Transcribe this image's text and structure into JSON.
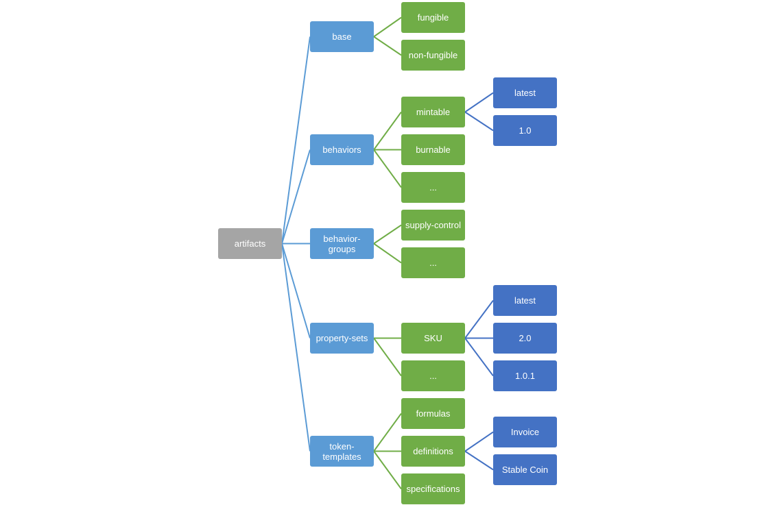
{
  "diagram": {
    "title": "",
    "colors": {
      "root": "#a5a5a5",
      "level1": "#5b9bd5",
      "level2": "#70ad47",
      "level3": "#4472c4",
      "link_level1": "#5b9bd5",
      "link_level2": "#70ad47",
      "link_level3": "#4472c4"
    },
    "root": {
      "id": "artifacts",
      "label": "artifacts",
      "children": [
        {
          "id": "base",
          "label": "base",
          "children": [
            {
              "id": "fungible",
              "label": "fungible",
              "children": []
            },
            {
              "id": "non-fungible",
              "label": "non-fungible",
              "children": []
            }
          ]
        },
        {
          "id": "behaviors",
          "label": "behaviors",
          "children": [
            {
              "id": "mintable",
              "label": "mintable",
              "children": [
                {
                  "id": "mintable-latest",
                  "label": "latest"
                },
                {
                  "id": "mintable-1-0",
                  "label": "1.0"
                }
              ]
            },
            {
              "id": "burnable",
              "label": "burnable",
              "children": []
            },
            {
              "id": "behaviors-more",
              "label": "...",
              "children": []
            }
          ]
        },
        {
          "id": "behavior-groups",
          "label": "behavior-\ngroups",
          "children": [
            {
              "id": "supply-control",
              "label": "supply-control",
              "children": []
            },
            {
              "id": "behavior-groups-more",
              "label": "...",
              "children": []
            }
          ]
        },
        {
          "id": "property-sets",
          "label": "property-sets",
          "children": [
            {
              "id": "sku",
              "label": "SKU",
              "children": [
                {
                  "id": "sku-latest",
                  "label": "latest"
                },
                {
                  "id": "sku-2-0",
                  "label": "2.0"
                },
                {
                  "id": "sku-1-0-1",
                  "label": "1.0.1"
                }
              ]
            },
            {
              "id": "property-sets-more",
              "label": "...",
              "children": []
            }
          ]
        },
        {
          "id": "token-templates",
          "label": "token-\ntemplates",
          "children": [
            {
              "id": "formulas",
              "label": "formulas",
              "children": []
            },
            {
              "id": "definitions",
              "label": "definitions",
              "children": [
                {
                  "id": "invoice",
                  "label": "Invoice"
                },
                {
                  "id": "stable-coin",
                  "label": "Stable Coin"
                }
              ]
            },
            {
              "id": "specifications",
              "label": "specifications",
              "children": []
            }
          ]
        }
      ]
    }
  }
}
